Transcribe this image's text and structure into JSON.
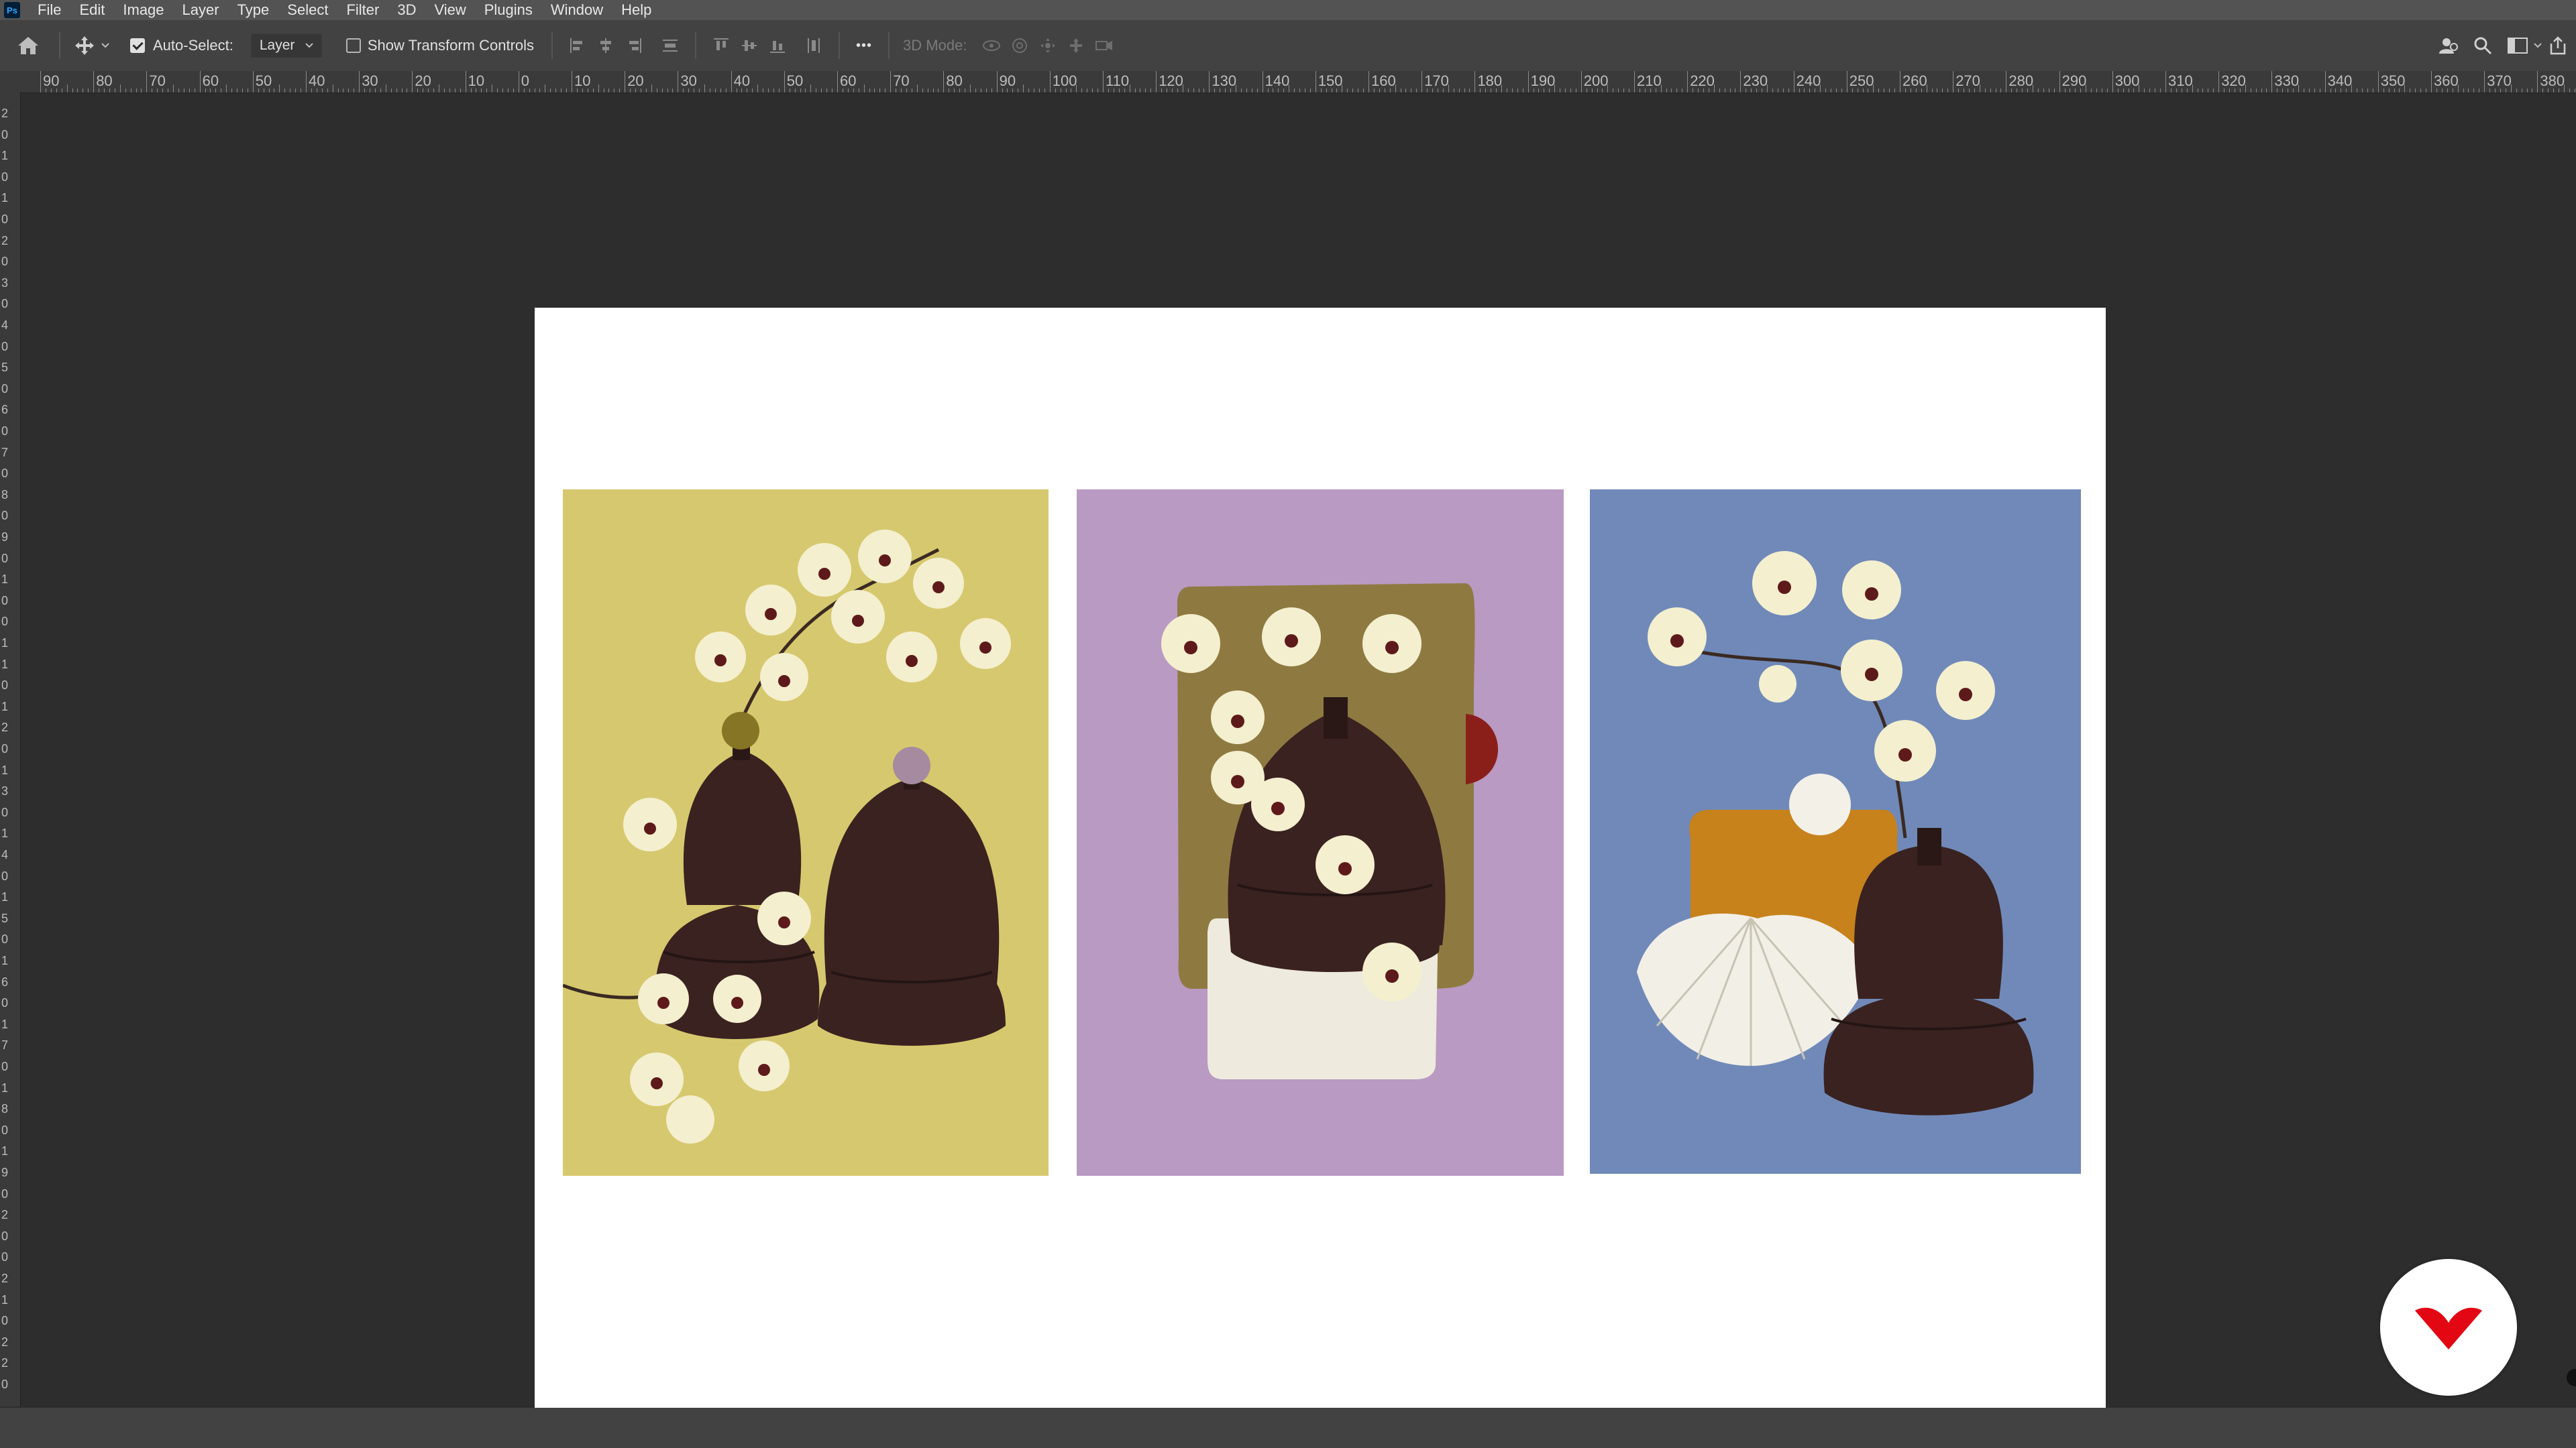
{
  "app": {
    "logo_text": "Ps"
  },
  "menu": [
    "File",
    "Edit",
    "Image",
    "Layer",
    "Type",
    "Select",
    "Filter",
    "3D",
    "View",
    "Plugins",
    "Window",
    "Help"
  ],
  "options_bar": {
    "auto_select_label": "Auto-Select:",
    "auto_select_checked": true,
    "auto_select_target": "Layer",
    "show_transform_label": "Show Transform Controls",
    "show_transform_checked": false,
    "more_label": "•••",
    "mode_3d_label": "3D Mode:"
  },
  "ruler_top": [
    "90",
    "80",
    "70",
    "60",
    "50",
    "40",
    "30",
    "20",
    "10",
    "0",
    "10",
    "20",
    "30",
    "40",
    "50",
    "60",
    "70",
    "80",
    "90",
    "100",
    "110",
    "120",
    "130",
    "140",
    "150",
    "160",
    "170",
    "180",
    "190",
    "200",
    "210",
    "220",
    "230",
    "240",
    "250",
    "260",
    "270",
    "280",
    "290",
    "300",
    "310",
    "320",
    "330",
    "340",
    "350",
    "360",
    "370",
    "380"
  ],
  "ruler_left": [
    "2",
    "0",
    "1",
    "0",
    "1",
    "0",
    "2",
    "0",
    "3",
    "0",
    "4",
    "0",
    "5",
    "0",
    "6",
    "0",
    "7",
    "0",
    "8",
    "0",
    "9",
    "0",
    "1",
    "0",
    "0",
    "1",
    "1",
    "0",
    "1",
    "2",
    "0",
    "1",
    "3",
    "0",
    "1",
    "4",
    "0",
    "1",
    "5",
    "0",
    "1",
    "6",
    "0",
    "1",
    "7",
    "0",
    "1",
    "8",
    "0",
    "1",
    "9",
    "0",
    "2",
    "0",
    "0",
    "2",
    "1",
    "0",
    "2",
    "2",
    "0"
  ],
  "artworks": [
    {
      "name": "yellow-orchid-vases",
      "background": "#d6c86e"
    },
    {
      "name": "lilac-orchid-vase",
      "background": "#b99ac3"
    },
    {
      "name": "blue-orchid-vase-shell",
      "background": "#7089b8"
    }
  ],
  "colors": {
    "accent_brand": "#e30613",
    "vase": "#3a2220",
    "petal": "#f4efcf",
    "panel_bg": "#2d2d2d"
  }
}
